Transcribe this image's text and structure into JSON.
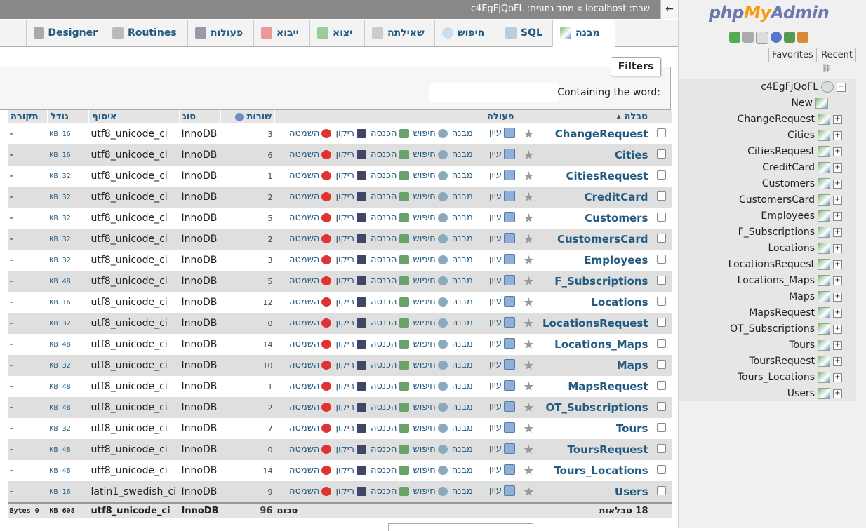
{
  "topbar": {
    "breadcrumb": "שרת: localhost » מסד נתונים: c4EgFjQoFL",
    "arrow": "←"
  },
  "tabs": [
    {
      "label": "מבנה",
      "icon": "structure-icon"
    },
    {
      "label": "SQL",
      "icon": "sql-icon"
    },
    {
      "label": "חיפוש",
      "icon": "search-icon"
    },
    {
      "label": "שאילתה",
      "icon": "query-icon"
    },
    {
      "label": "יצוא",
      "icon": "export-icon"
    },
    {
      "label": "ייבוא",
      "icon": "import-icon"
    },
    {
      "label": "פעולות",
      "icon": "wrench-icon"
    },
    {
      "label": "Routines",
      "icon": "routines-icon"
    },
    {
      "label": "Designer",
      "icon": "designer-icon"
    }
  ],
  "filters": {
    "legend": "Filters",
    "label": "Containing the word:",
    "value": ""
  },
  "table": {
    "headers": {
      "table": "טבלה",
      "action": "פעולה",
      "rows": "שורות",
      "type": "סוג",
      "collation": "איסוף",
      "size": "גודל",
      "overhead": "תקורה"
    },
    "actions": {
      "browse": "עיון",
      "structure": "מבנה",
      "search": "חיפוש",
      "insert": "הכנסה",
      "empty": "ריקון",
      "drop": "השמטה"
    },
    "rows": [
      {
        "name": "ChangeRequest",
        "rows": "3",
        "engine": "InnoDB",
        "collation": "utf8_unicode_ci",
        "size": "16 KB",
        "overhead": "-"
      },
      {
        "name": "Cities",
        "rows": "6",
        "engine": "InnoDB",
        "collation": "utf8_unicode_ci",
        "size": "16 KB",
        "overhead": "-"
      },
      {
        "name": "CitiesRequest",
        "rows": "1",
        "engine": "InnoDB",
        "collation": "utf8_unicode_ci",
        "size": "32 KB",
        "overhead": "-"
      },
      {
        "name": "CreditCard",
        "rows": "2",
        "engine": "InnoDB",
        "collation": "utf8_unicode_ci",
        "size": "32 KB",
        "overhead": "-"
      },
      {
        "name": "Customers",
        "rows": "5",
        "engine": "InnoDB",
        "collation": "utf8_unicode_ci",
        "size": "32 KB",
        "overhead": "-"
      },
      {
        "name": "CustomersCard",
        "rows": "2",
        "engine": "InnoDB",
        "collation": "utf8_unicode_ci",
        "size": "32 KB",
        "overhead": "-"
      },
      {
        "name": "Employees",
        "rows": "3",
        "engine": "InnoDB",
        "collation": "utf8_unicode_ci",
        "size": "32 KB",
        "overhead": "-"
      },
      {
        "name": "F_Subscriptions",
        "rows": "5",
        "engine": "InnoDB",
        "collation": "utf8_unicode_ci",
        "size": "48 KB",
        "overhead": "-"
      },
      {
        "name": "Locations",
        "rows": "12",
        "engine": "InnoDB",
        "collation": "utf8_unicode_ci",
        "size": "16 KB",
        "overhead": "-"
      },
      {
        "name": "LocationsRequest",
        "rows": "0",
        "engine": "InnoDB",
        "collation": "utf8_unicode_ci",
        "size": "32 KB",
        "overhead": "-"
      },
      {
        "name": "Locations_Maps",
        "rows": "14",
        "engine": "InnoDB",
        "collation": "utf8_unicode_ci",
        "size": "48 KB",
        "overhead": "-"
      },
      {
        "name": "Maps",
        "rows": "10",
        "engine": "InnoDB",
        "collation": "utf8_unicode_ci",
        "size": "32 KB",
        "overhead": "-"
      },
      {
        "name": "MapsRequest",
        "rows": "1",
        "engine": "InnoDB",
        "collation": "utf8_unicode_ci",
        "size": "48 KB",
        "overhead": "-"
      },
      {
        "name": "OT_Subscriptions",
        "rows": "2",
        "engine": "InnoDB",
        "collation": "utf8_unicode_ci",
        "size": "48 KB",
        "overhead": "-"
      },
      {
        "name": "Tours",
        "rows": "7",
        "engine": "InnoDB",
        "collation": "utf8_unicode_ci",
        "size": "32 KB",
        "overhead": "-"
      },
      {
        "name": "ToursRequest",
        "rows": "0",
        "engine": "InnoDB",
        "collation": "utf8_unicode_ci",
        "size": "48 KB",
        "overhead": "-"
      },
      {
        "name": "Tours_Locations",
        "rows": "14",
        "engine": "InnoDB",
        "collation": "utf8_unicode_ci",
        "size": "48 KB",
        "overhead": "-"
      },
      {
        "name": "Users",
        "rows": "9",
        "engine": "InnoDB",
        "collation": "latin1_swedish_ci",
        "size": "16 KB",
        "overhead": "-"
      }
    ],
    "summary": {
      "tables": "18 טבלאות",
      "label": "סכום",
      "rows": "96",
      "engine": "InnoDB",
      "collation": "utf8_unicode_ci",
      "size": "608 KB",
      "overhead": "0 Bytes"
    }
  },
  "nav": {
    "logo": {
      "php": "php",
      "my": "My",
      "admin": "Admin"
    },
    "favorites": "Favorites",
    "recent": "Recent",
    "db_name": "c4EgFjQoFL",
    "new": "New",
    "tables": [
      "ChangeRequest",
      "Cities",
      "CitiesRequest",
      "CreditCard",
      "Customers",
      "CustomersCard",
      "Employees",
      "F_Subscriptions",
      "Locations",
      "LocationsRequest",
      "Locations_Maps",
      "Maps",
      "MapsRequest",
      "OT_Subscriptions",
      "Tours",
      "ToursRequest",
      "Tours_Locations",
      "Users"
    ]
  },
  "colors": {
    "link": "#235a81",
    "topbar": "#888888",
    "logo_blue": "#6c78af",
    "logo_orange": "#f89c0e"
  }
}
